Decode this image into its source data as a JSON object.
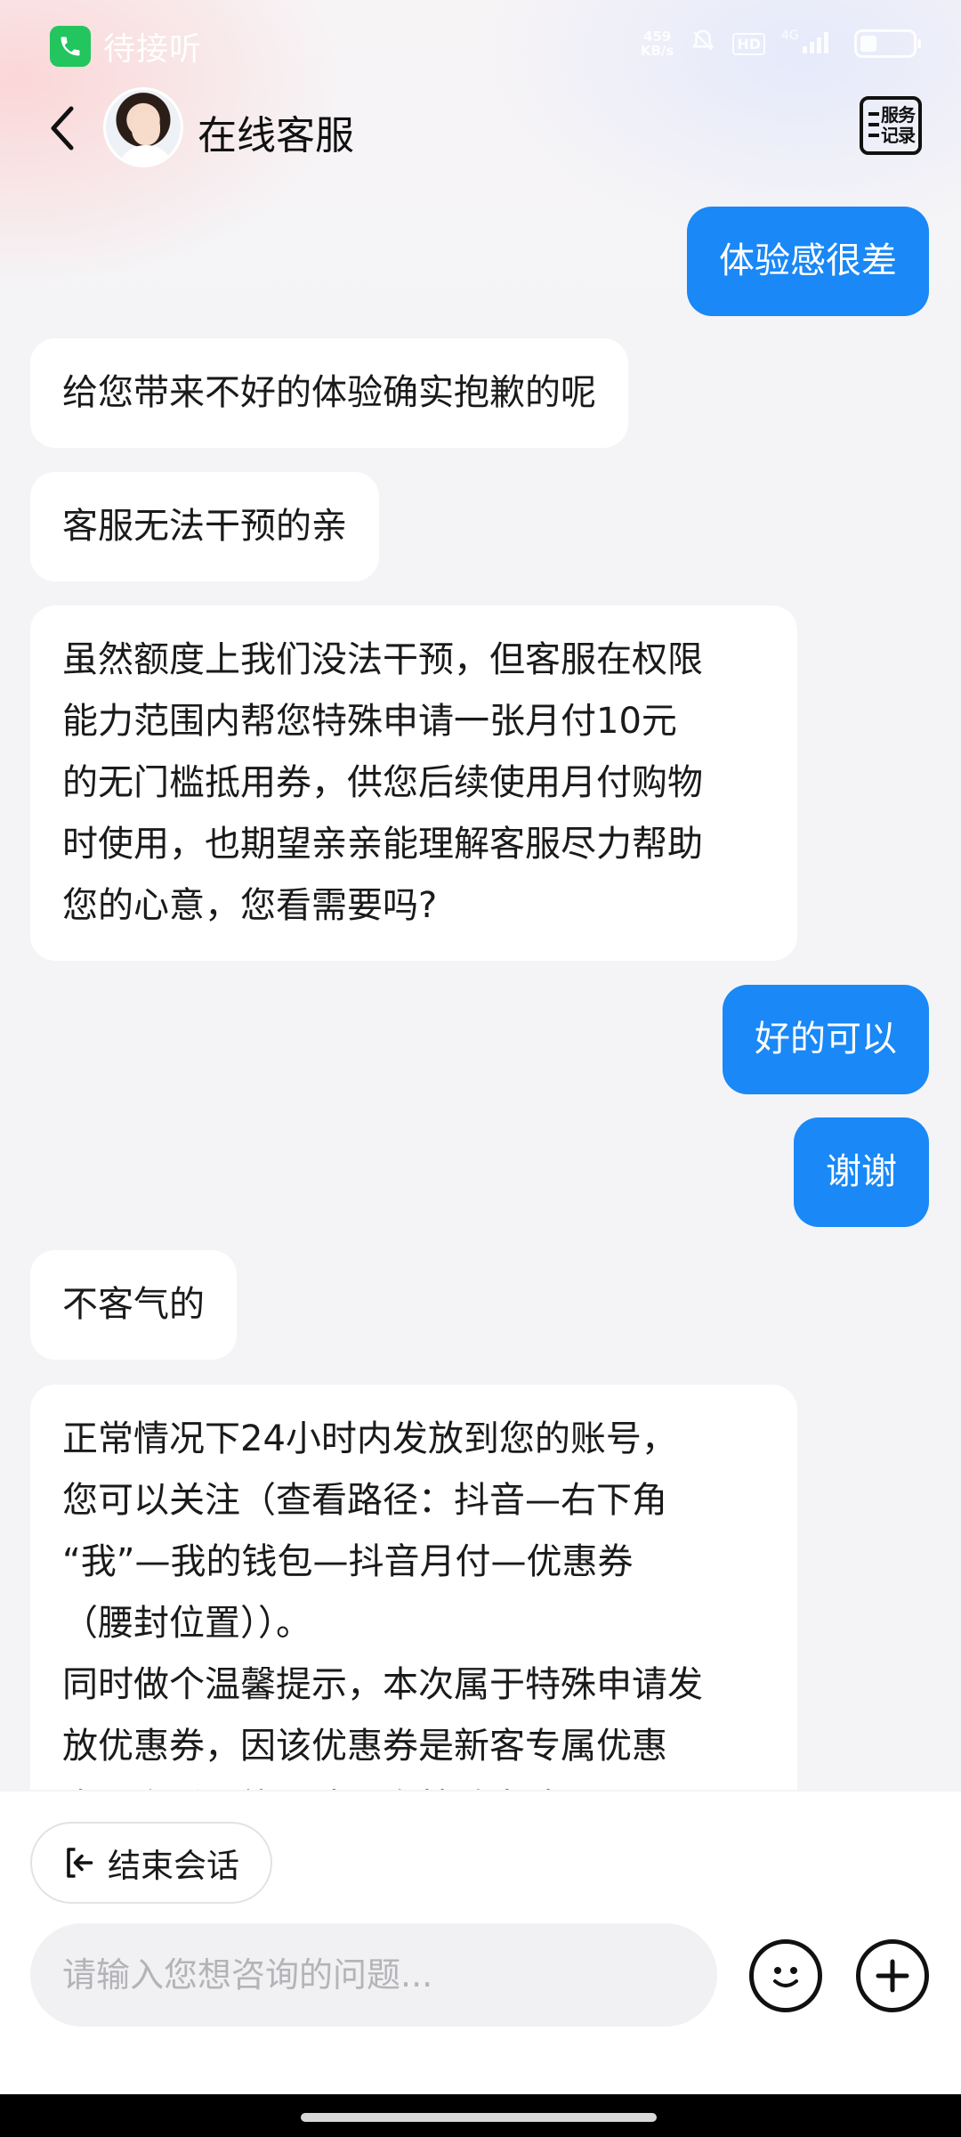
{
  "status_bar": {
    "call_text": "待接听",
    "net_speed_top": "459",
    "net_speed_bottom": "KB/s",
    "hd_label": "HD",
    "signal_label": "4G"
  },
  "header": {
    "title": "在线客服",
    "service_record_line1": "服务",
    "service_record_line2": "记录"
  },
  "messages": [
    {
      "from": "user",
      "text": "体验感很差"
    },
    {
      "from": "agent",
      "text": "给您带来不好的体验确实抱歉的呢"
    },
    {
      "from": "agent",
      "text": "客服无法干预的亲"
    },
    {
      "from": "agent",
      "text": "虽然额度上我们没法干预，但客服在权限\n能力范围内帮您特殊申请一张月付10元\n的无门槛抵用券，供您后续使用月付购物\n时使用，也期望亲亲能理解客服尽力帮助\n您的心意，您看需要吗?"
    },
    {
      "from": "user",
      "text": "好的可以"
    },
    {
      "from": "user",
      "text": "谢谢"
    },
    {
      "from": "agent",
      "text": "不客气的"
    },
    {
      "from": "agent",
      "text": "正常情况下24小时内发放到您的账号，\n您可以关注（查看路径：抖音—右下角\n“我”—我的钱包—抖音月付—优惠券\n（腰封位置））。\n同时做个温馨提示，本次属于特殊申请发\n放优惠券，因该优惠券是新客专属优惠\n券，之后可能无法再次特殊申请"
    }
  ],
  "bottom": {
    "end_session_label": "结束会话",
    "input_placeholder": "请输入您想咨询的问题..."
  },
  "colors": {
    "user_bubble": "#1a88f6",
    "agent_bubble": "#ffffff",
    "background": "#f4f4f6"
  },
  "icons": {
    "call": "phone-icon",
    "back": "chevron-left-icon",
    "record": "service-record-icon",
    "end": "exit-icon",
    "emoji": "emoji-face-icon",
    "more": "plus-circle-icon"
  }
}
